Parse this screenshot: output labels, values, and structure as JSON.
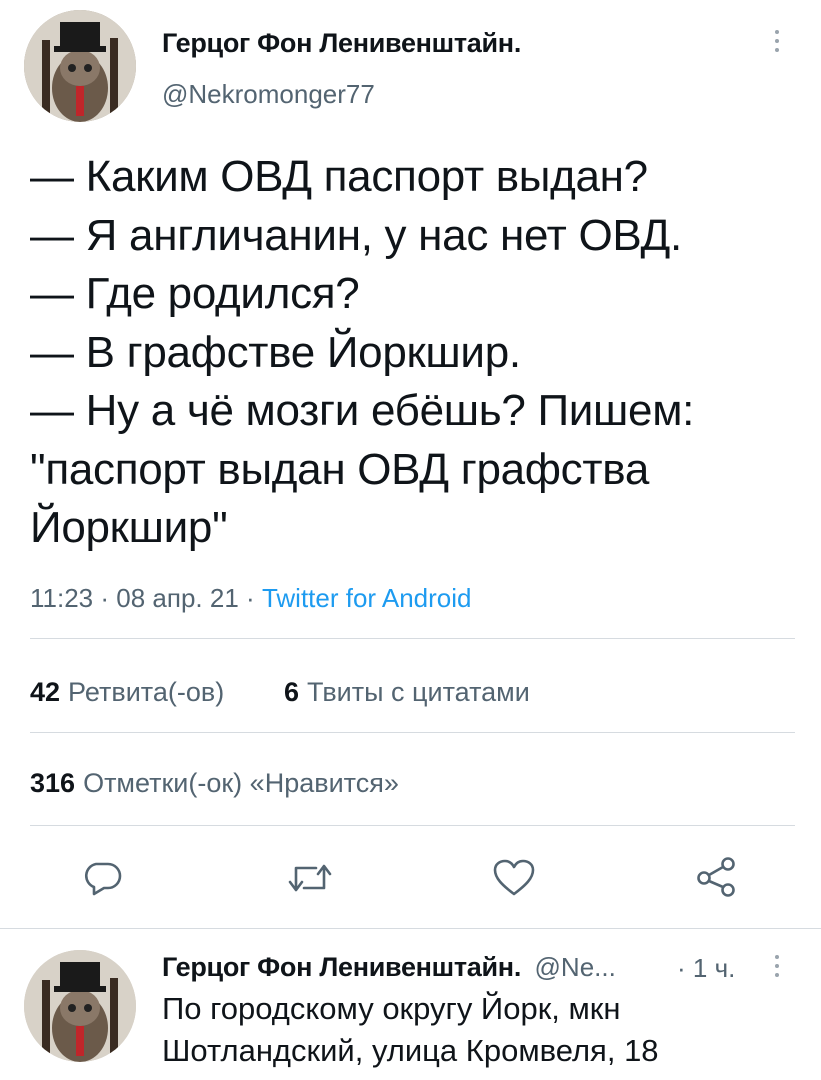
{
  "tweet": {
    "author_name": "Герцог Фон Ленивенштайн.",
    "author_handle": "@Nekromonger77",
    "body": "— Каким ОВД паспорт выдан?\n— Я англичанин, у нас нет ОВД.\n— Где родился?\n— В графстве Йоркшир.\n— Ну а чё мозги ебёшь? Пишем: \"паспорт выдан ОВД графства Йоркшир\"",
    "time": "11:23",
    "date": "08 апр. 21",
    "separator": "·",
    "source": "Twitter for Android",
    "retweets_count": "42",
    "retweets_label": "Ретвита(-ов)",
    "quotes_count": "6",
    "quotes_label": "Твиты с цитатами",
    "likes_count": "316",
    "likes_label": "Отметки(-ок) «Нравится»"
  },
  "actions": {
    "reply_icon": "reply-icon",
    "retweet_icon": "retweet-icon",
    "like_icon": "like-icon",
    "share_icon": "share-icon"
  },
  "reply": {
    "author_name": "Герцог Фон Ленивенштайн.",
    "author_handle": "@Ne...",
    "separator": "·",
    "time_ago": "1 ч.",
    "text": "По городскому округу Йорк, мкн\nШотландский, улица Кромвеля, 18"
  },
  "colors": {
    "text": "#0f1419",
    "secondary": "#536471",
    "link": "#1d9bf0",
    "divider": "#d6dbe0"
  }
}
